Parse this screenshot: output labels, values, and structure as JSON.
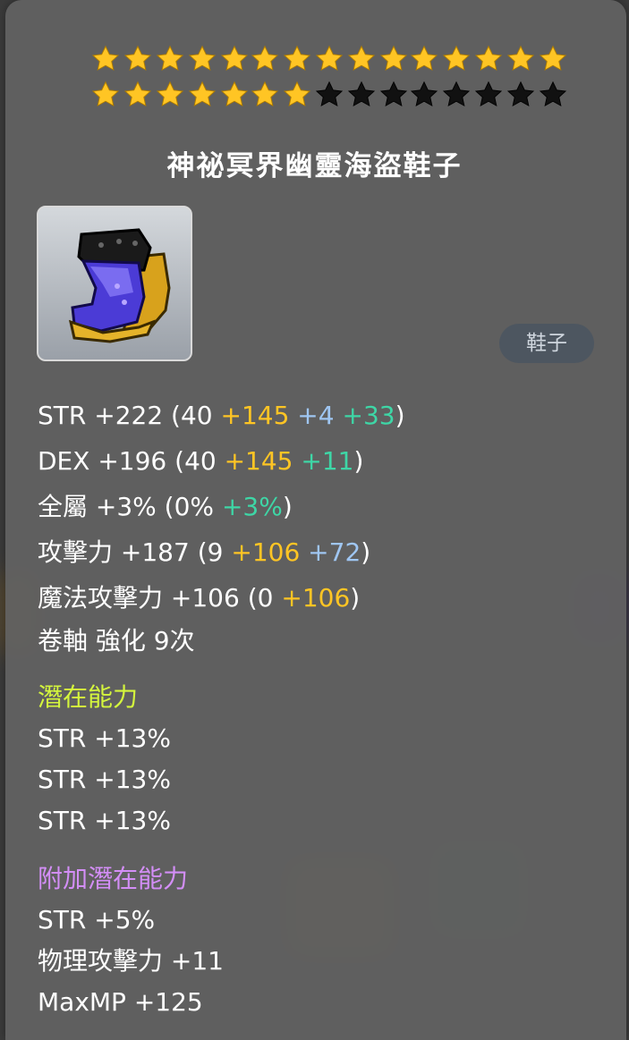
{
  "colors": {
    "star_gold": "#ffc524",
    "star_empty": "#111111",
    "potential_header": "#d4f53d",
    "additional_potential_header": "#d38ef6",
    "scroll_bonus": "#ffc524",
    "flame_bonus": "#3ed6a6",
    "enhance_bonus": "#9fc6f2"
  },
  "stars": {
    "filled": 22,
    "total": 30
  },
  "item": {
    "name": "神祕冥界幽靈海盜鞋子",
    "type_badge": "鞋子",
    "icon": "boots-icon"
  },
  "stats": {
    "str": {
      "label": "STR +222 (40 ",
      "a": "+145",
      "b": " +4",
      "c": " +33",
      "end": ")"
    },
    "dex": {
      "label": "DEX +196 (40 ",
      "a": "+145",
      "c": " +11",
      "end": ")"
    },
    "all": {
      "label": "全屬 +3% (0% ",
      "c": "+3%",
      "end": ")"
    },
    "atk": {
      "label": "攻擊力 +187  (9 ",
      "a": "+106",
      "b": " +72",
      "end": ")"
    },
    "matk": {
      "label": "魔法攻擊力 +106  (0 ",
      "a": "+106",
      "end": ")"
    },
    "scroll": "卷軸 強化 9次"
  },
  "potential": {
    "header": "潛在能力",
    "lines": [
      "STR +13%",
      "STR +13%",
      "STR +13%"
    ]
  },
  "additional_potential": {
    "header": "附加潛在能力",
    "lines": [
      "STR +5%",
      "物理攻擊力 +11",
      "MaxMP +125"
    ]
  }
}
